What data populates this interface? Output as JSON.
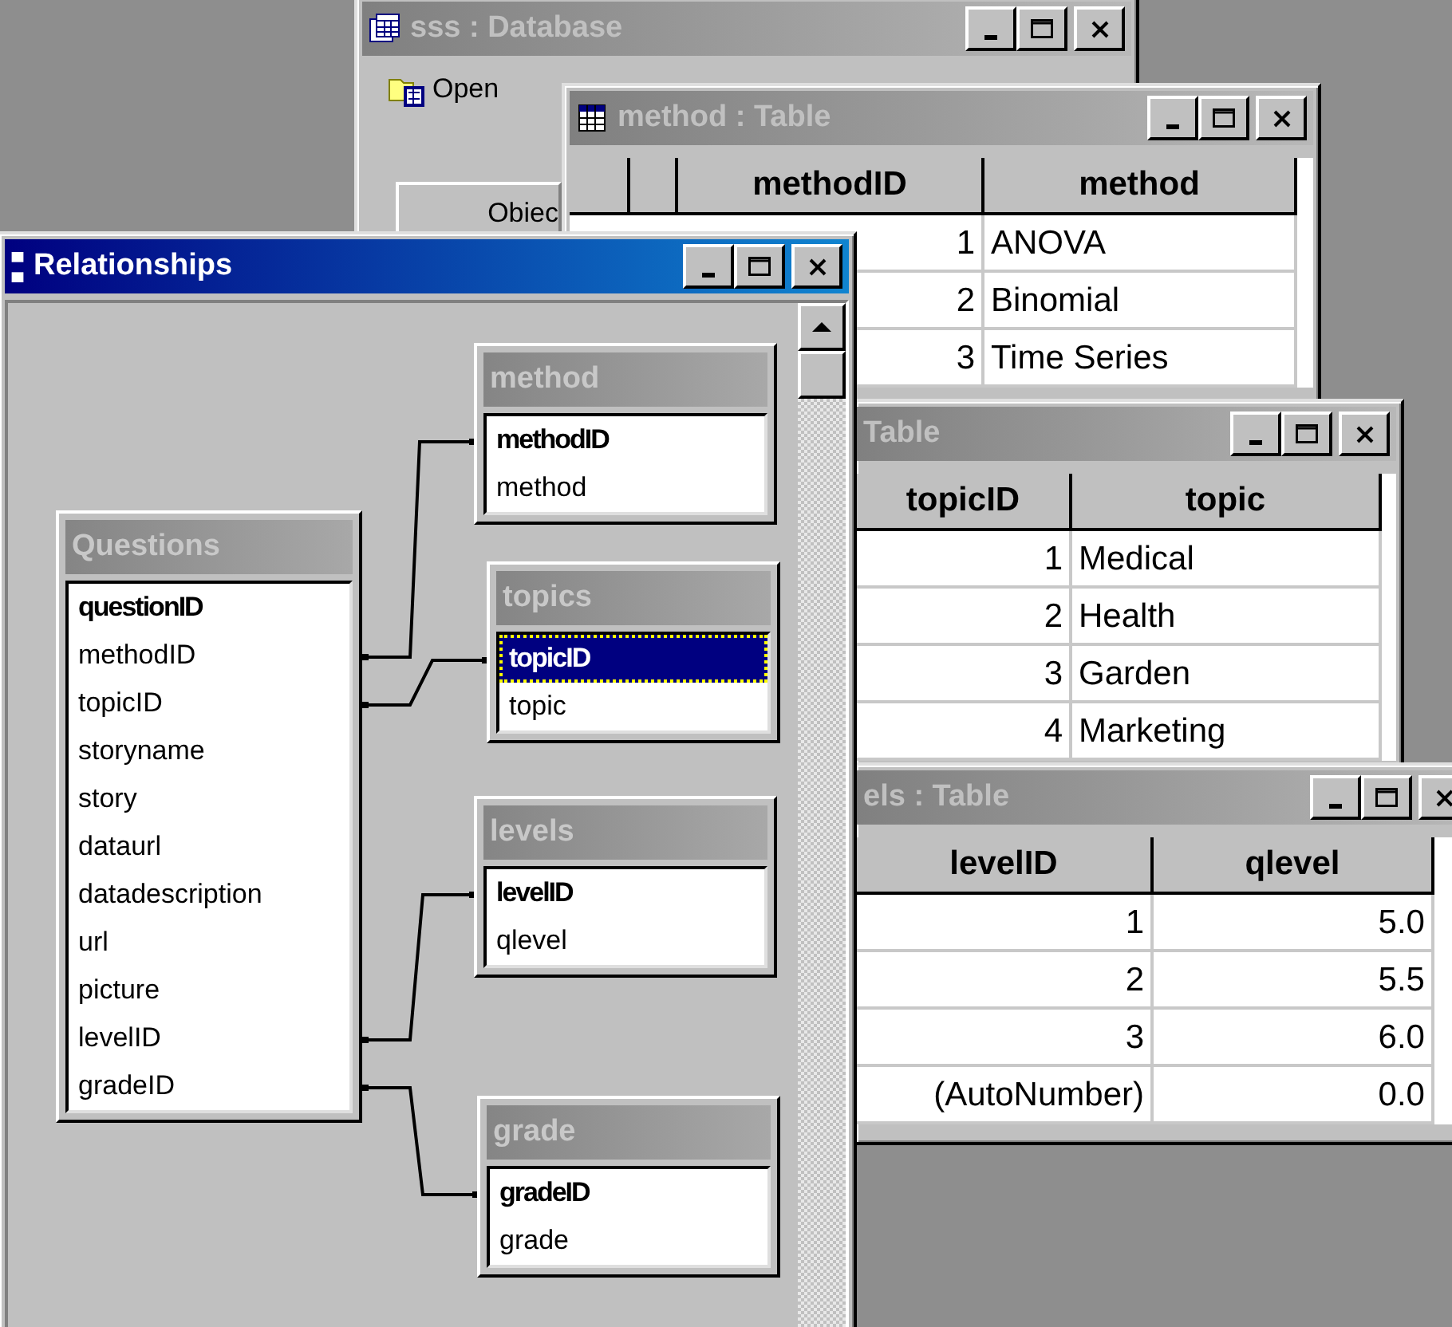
{
  "database_window": {
    "title": "sss : Database",
    "toolbar": [
      {
        "label": "Open"
      }
    ],
    "tab": {
      "label": "Obiec"
    }
  },
  "method_table": {
    "title": "method : Table",
    "columns": [
      {
        "label": "methodID"
      },
      {
        "label": "method"
      }
    ],
    "rows": [
      [
        "1",
        "ANOVA"
      ],
      [
        "2",
        "Binomial"
      ],
      [
        "3",
        "Time Series"
      ]
    ]
  },
  "topics_table": {
    "title": "Table",
    "columns": [
      {
        "label": "topicID"
      },
      {
        "label": "topic"
      }
    ],
    "rows": [
      [
        "1",
        "Medical"
      ],
      [
        "2",
        "Health"
      ],
      [
        "3",
        "Garden"
      ],
      [
        "4",
        "Marketing"
      ]
    ]
  },
  "levels_table": {
    "title": "els : Table",
    "columns": [
      {
        "label": "levelID"
      },
      {
        "label": "qlevel"
      }
    ],
    "rows": [
      [
        "1",
        "5.0"
      ],
      [
        "2",
        "5.5"
      ],
      [
        "3",
        "6.0"
      ],
      [
        "(AutoNumber)",
        "0.0"
      ]
    ]
  },
  "relationships": {
    "title": "Relationships",
    "tables": [
      {
        "name": "method",
        "fields": [
          {
            "name": "methodID",
            "key": true,
            "selected": false
          },
          {
            "name": "method",
            "key": false,
            "selected": false
          }
        ]
      },
      {
        "name": "Questions",
        "fields": [
          {
            "name": "questionID",
            "key": true,
            "selected": false
          },
          {
            "name": "methodID",
            "key": false,
            "selected": false
          },
          {
            "name": "topicID",
            "key": false,
            "selected": false
          },
          {
            "name": "storyname",
            "key": false,
            "selected": false
          },
          {
            "name": "story",
            "key": false,
            "selected": false
          },
          {
            "name": "dataurl",
            "key": false,
            "selected": false
          },
          {
            "name": "datadescription",
            "key": false,
            "selected": false
          },
          {
            "name": "url",
            "key": false,
            "selected": false
          },
          {
            "name": "picture",
            "key": false,
            "selected": false
          },
          {
            "name": "levelID",
            "key": false,
            "selected": false
          },
          {
            "name": "gradeID",
            "key": false,
            "selected": false
          }
        ]
      },
      {
        "name": "topics",
        "fields": [
          {
            "name": "topicID",
            "key": true,
            "selected": true
          },
          {
            "name": "topic",
            "key": false,
            "selected": false
          }
        ]
      },
      {
        "name": "levels",
        "fields": [
          {
            "name": "levelID",
            "key": true,
            "selected": false
          },
          {
            "name": "qlevel",
            "key": false,
            "selected": false
          }
        ]
      },
      {
        "name": "grade",
        "fields": [
          {
            "name": "gradeID",
            "key": true,
            "selected": false
          },
          {
            "name": "grade",
            "key": false,
            "selected": false
          }
        ]
      }
    ]
  }
}
